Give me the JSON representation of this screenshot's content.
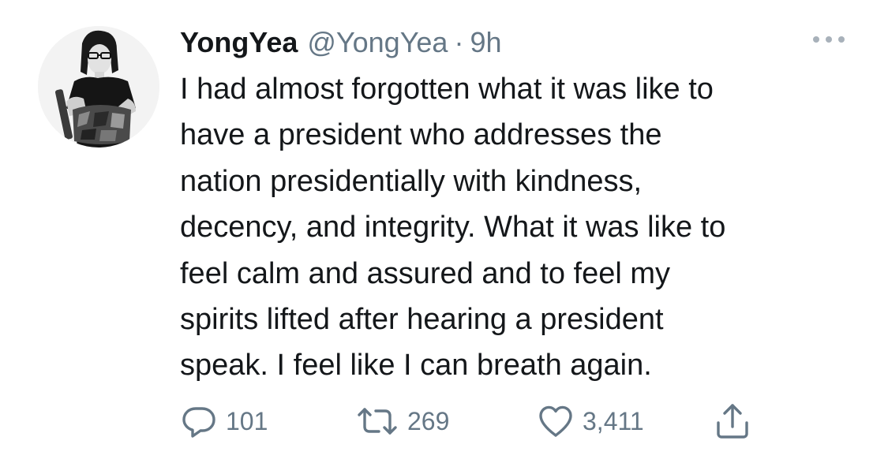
{
  "tweet": {
    "author": {
      "display_name": "YongYea",
      "handle": "@YongYea"
    },
    "separator": "·",
    "time": "9h",
    "text_lines": [
      "I had almost forgotten what it was like to",
      "have a president who addresses the",
      "nation presidentially with kindness,",
      "decency, and integrity. What it was like to",
      "feel calm and assured and to feel my",
      "spirits lifted after hearing a president",
      "speak. I feel like I can breath again."
    ],
    "actions": {
      "reply": {
        "icon": "reply-icon",
        "count": "101"
      },
      "retweet": {
        "icon": "retweet-icon",
        "count": "269"
      },
      "like": {
        "icon": "heart-icon",
        "count": "3,411"
      },
      "share": {
        "icon": "share-icon"
      }
    },
    "more_icon": "more-options-icon",
    "colors": {
      "text": "#14171a",
      "secondary": "#657786",
      "background": "#ffffff"
    }
  }
}
